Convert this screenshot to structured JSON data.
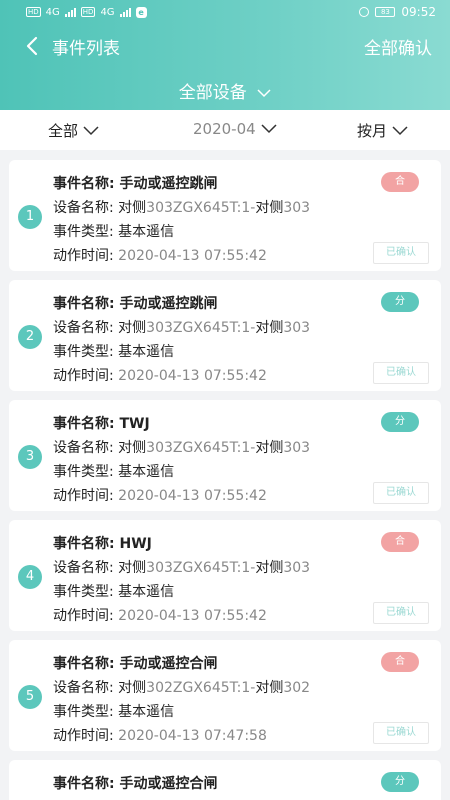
{
  "status_bar": {
    "tags": [
      "HD",
      "HD"
    ],
    "net_labels": [
      "4G",
      "4G"
    ],
    "e_icon": "e",
    "battery": "83",
    "time": "09:52"
  },
  "nav": {
    "title": "事件列表",
    "confirm_all": "全部确认",
    "device_selector": "全部设备"
  },
  "filters": {
    "all": "全部",
    "date": "2020-04",
    "period": "按月"
  },
  "labels": {
    "event_name": "事件名称: ",
    "device_name": "设备名称: ",
    "event_type": "事件类型: ",
    "action_time": "动作时间: ",
    "confirmed": "已确认"
  },
  "events": [
    {
      "index": "1",
      "name": "手动或遥控跳闸",
      "device_prefix": "对侧",
      "device_code": "303ZGX645T:1-",
      "device_mid": "对侧",
      "device_suffix": "303",
      "type": "基本遥信",
      "time": "2020-04-13 07:55:42",
      "tag": "合",
      "tag_kind": "he"
    },
    {
      "index": "2",
      "name": "手动或遥控跳闸",
      "device_prefix": "对侧",
      "device_code": "303ZGX645T:1-",
      "device_mid": "对侧",
      "device_suffix": "303",
      "type": "基本遥信",
      "time": "2020-04-13 07:55:42",
      "tag": "分",
      "tag_kind": "fen"
    },
    {
      "index": "3",
      "name": "TWJ",
      "device_prefix": "对侧",
      "device_code": "303ZGX645T:1-",
      "device_mid": "对侧",
      "device_suffix": "303",
      "type": "基本遥信",
      "time": "2020-04-13 07:55:42",
      "tag": "分",
      "tag_kind": "fen"
    },
    {
      "index": "4",
      "name": "HWJ",
      "device_prefix": "对侧",
      "device_code": "303ZGX645T:1-",
      "device_mid": "对侧",
      "device_suffix": "303",
      "type": "基本遥信",
      "time": "2020-04-13 07:55:42",
      "tag": "合",
      "tag_kind": "he"
    },
    {
      "index": "5",
      "name": "手动或遥控合闸",
      "device_prefix": "对侧",
      "device_code": "302ZGX645T:1-",
      "device_mid": "对侧",
      "device_suffix": "302",
      "type": "基本遥信",
      "time": "2020-04-13 07:47:58",
      "tag": "合",
      "tag_kind": "he"
    },
    {
      "index": "6",
      "name": "手动或遥控合闸",
      "device_prefix": "",
      "device_code": "",
      "device_mid": "",
      "device_suffix": "",
      "type": "",
      "time": "",
      "tag": "分",
      "tag_kind": "fen"
    }
  ],
  "colors": {
    "accent": "#5cc7bc",
    "tag_he": "#f2a3a3",
    "tag_fen": "#5cc7bc"
  }
}
